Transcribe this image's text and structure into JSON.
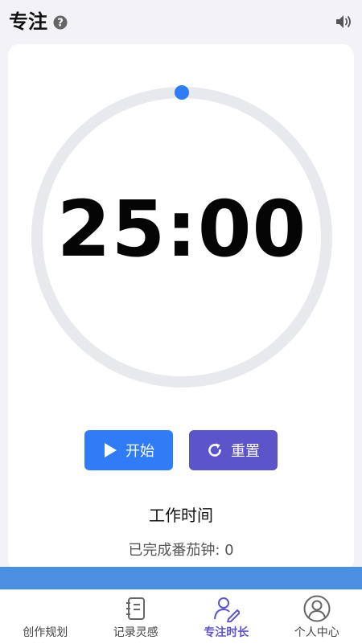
{
  "header": {
    "title": "专注",
    "help_icon": "question-circle-icon",
    "sound_icon": "speaker-volume-icon"
  },
  "timer": {
    "display": "25:00",
    "progress": 0,
    "ring_color": "#e8e9ec",
    "knob_color": "#2f7cf6"
  },
  "buttons": {
    "start_label": "开始",
    "start_icon": "play-icon",
    "start_color": "#2f7cf6",
    "reset_label": "重置",
    "reset_icon": "refresh-icon",
    "reset_color": "#5b55c9"
  },
  "status": {
    "mode": "工作时间",
    "completed_text": "已完成番茄钟: 0"
  },
  "tabbar": {
    "active": 2,
    "accent_color": "#5b55c9",
    "items": [
      {
        "label": "创作规划",
        "icon": ""
      },
      {
        "label": "记录灵感",
        "icon": "notebook-icon"
      },
      {
        "label": "专注时长",
        "icon": "person-edit-icon"
      },
      {
        "label": "个人中心",
        "icon": "user-circle-icon"
      }
    ]
  }
}
